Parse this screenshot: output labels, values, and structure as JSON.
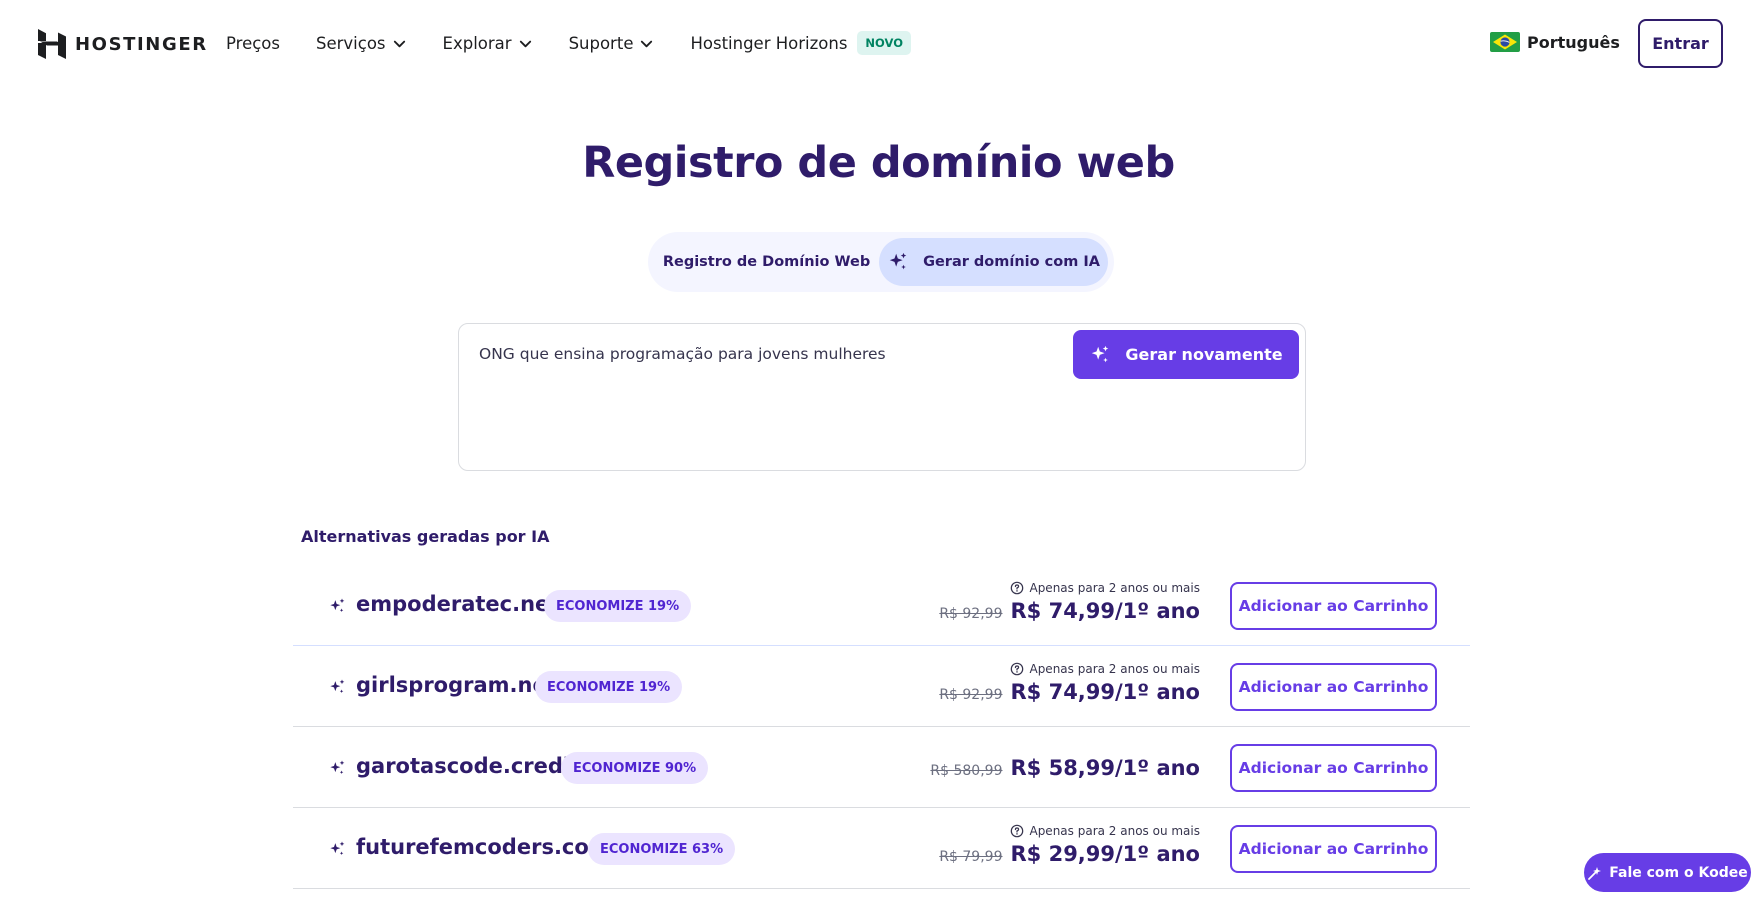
{
  "header": {
    "logo_text": "HOSTINGER",
    "nav": [
      {
        "label": "Preços",
        "has_chevron": false
      },
      {
        "label": "Serviços",
        "has_chevron": true
      },
      {
        "label": "Explorar",
        "has_chevron": true
      },
      {
        "label": "Suporte",
        "has_chevron": true
      },
      {
        "label": "Hostinger Horizons",
        "has_chevron": false
      }
    ],
    "new_badge": "NOVO",
    "language": "Português",
    "login_label": "Entrar"
  },
  "main": {
    "title": "Registro de domínio web",
    "tabs": [
      {
        "label": "Registro de Domínio Web",
        "active": false
      },
      {
        "label": "Gerar domínio com IA",
        "active": true
      }
    ],
    "search": {
      "value": "ONG que ensina programação para jovens mulheres",
      "button_label": "Gerar novamente"
    },
    "results_heading": "Alternativas geradas por IA",
    "results": [
      {
        "domain": "empoderatec.net",
        "badge": "ECONOMIZE 19%",
        "note": "Apenas para 2 anos ou mais",
        "old_price": "R$ 92,99",
        "price": "R$ 74,99/1º ano",
        "cart_label": "Adicionar ao Carrinho"
      },
      {
        "domain": "girlsprogram.net",
        "badge": "ECONOMIZE 19%",
        "note": "Apenas para 2 anos ou mais",
        "old_price": "R$ 92,99",
        "price": "R$ 74,99/1º ano",
        "cart_label": "Adicionar ao Carrinho"
      },
      {
        "domain": "garotascode.credit",
        "badge": "ECONOMIZE 90%",
        "note": "",
        "old_price": "R$ 580,99",
        "price": "R$ 58,99/1º ano",
        "cart_label": "Adicionar ao Carrinho"
      },
      {
        "domain": "futurefemcoders.com",
        "badge": "ECONOMIZE 63%",
        "note": "Apenas para 2 anos ou mais",
        "old_price": "R$ 79,99",
        "price": "R$ 29,99/1º ano",
        "cart_label": "Adicionar ao Carrinho"
      }
    ]
  },
  "chat": {
    "label": "Fale com o Kodee"
  },
  "colors": {
    "brand_primary": "#673de6",
    "heading": "#2f1c6a",
    "badge_bg": "#ebe4ff",
    "tab_active_bg": "#d5dfff",
    "new_badge_bg": "#def4f0",
    "new_badge_text": "#008361"
  }
}
